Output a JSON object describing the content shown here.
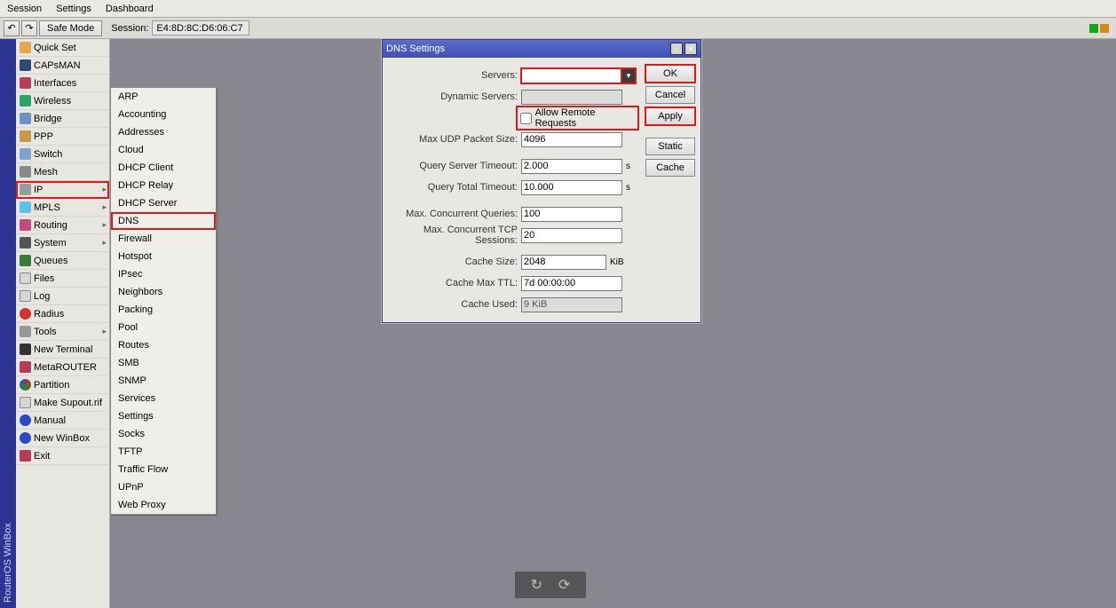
{
  "menubar": {
    "session": "Session",
    "settings": "Settings",
    "dashboard": "Dashboard"
  },
  "toolbar": {
    "undo_icon": "↶",
    "redo_icon": "↷",
    "safemode": "Safe Mode",
    "session_label": "Session:",
    "session_value": "E4:8D:8C:D6:06:C7"
  },
  "status": {
    "green_color": "#17a31a",
    "amber_color": "#d68a17"
  },
  "brand": "RouterOS WinBox",
  "sidebar": [
    {
      "label": "Quick Set",
      "icon": "i-quick",
      "arrow": false
    },
    {
      "label": "CAPsMAN",
      "icon": "i-caps",
      "arrow": false
    },
    {
      "label": "Interfaces",
      "icon": "i-if",
      "arrow": false
    },
    {
      "label": "Wireless",
      "icon": "i-wl",
      "arrow": false
    },
    {
      "label": "Bridge",
      "icon": "i-br",
      "arrow": false
    },
    {
      "label": "PPP",
      "icon": "i-ppp",
      "arrow": false
    },
    {
      "label": "Switch",
      "icon": "i-sw",
      "arrow": false
    },
    {
      "label": "Mesh",
      "icon": "i-mesh",
      "arrow": false
    },
    {
      "label": "IP",
      "icon": "i-ip",
      "arrow": true,
      "hl": true
    },
    {
      "label": "MPLS",
      "icon": "i-mpls",
      "arrow": true
    },
    {
      "label": "Routing",
      "icon": "i-rt",
      "arrow": true
    },
    {
      "label": "System",
      "icon": "i-sys",
      "arrow": true
    },
    {
      "label": "Queues",
      "icon": "i-queue",
      "arrow": false
    },
    {
      "label": "Files",
      "icon": "i-files",
      "arrow": false
    },
    {
      "label": "Log",
      "icon": "i-log",
      "arrow": false
    },
    {
      "label": "Radius",
      "icon": "i-radius",
      "arrow": false
    },
    {
      "label": "Tools",
      "icon": "i-tools",
      "arrow": true
    },
    {
      "label": "New Terminal",
      "icon": "i-term",
      "arrow": false
    },
    {
      "label": "MetaROUTER",
      "icon": "i-meta",
      "arrow": false
    },
    {
      "label": "Partition",
      "icon": "i-part",
      "arrow": false
    },
    {
      "label": "Make Supout.rif",
      "icon": "i-supout",
      "arrow": false
    },
    {
      "label": "Manual",
      "icon": "i-man",
      "arrow": false
    },
    {
      "label": "New WinBox",
      "icon": "i-newwb",
      "arrow": false
    },
    {
      "label": "Exit",
      "icon": "i-exit",
      "arrow": false
    }
  ],
  "submenu": [
    {
      "label": "ARP"
    },
    {
      "label": "Accounting"
    },
    {
      "label": "Addresses"
    },
    {
      "label": "Cloud"
    },
    {
      "label": "DHCP Client"
    },
    {
      "label": "DHCP Relay"
    },
    {
      "label": "DHCP Server"
    },
    {
      "label": "DNS",
      "hl": true
    },
    {
      "label": "Firewall"
    },
    {
      "label": "Hotspot"
    },
    {
      "label": "IPsec"
    },
    {
      "label": "Neighbors"
    },
    {
      "label": "Packing"
    },
    {
      "label": "Pool"
    },
    {
      "label": "Routes"
    },
    {
      "label": "SMB"
    },
    {
      "label": "SNMP"
    },
    {
      "label": "Services"
    },
    {
      "label": "Settings"
    },
    {
      "label": "Socks"
    },
    {
      "label": "TFTP"
    },
    {
      "label": "Traffic Flow"
    },
    {
      "label": "UPnP"
    },
    {
      "label": "Web Proxy"
    }
  ],
  "dialog": {
    "title": "DNS Settings",
    "labels": {
      "servers": "Servers:",
      "dynamic_servers": "Dynamic Servers:",
      "allow_remote": "Allow Remote Requests",
      "max_udp": "Max UDP Packet Size:",
      "query_server_timeout": "Query Server Timeout:",
      "query_total_timeout": "Query Total Timeout:",
      "max_conc_queries": "Max. Concurrent Queries:",
      "max_conc_tcp": "Max. Concurrent TCP Sessions:",
      "cache_size": "Cache Size:",
      "cache_max_ttl": "Cache Max TTL:",
      "cache_used": "Cache Used:"
    },
    "values": {
      "servers": "",
      "dynamic_servers": "",
      "allow_remote": false,
      "max_udp": "4096",
      "query_server_timeout": "2.000",
      "query_total_timeout": "10.000",
      "max_conc_queries": "100",
      "max_conc_tcp": "20",
      "cache_size": "2048",
      "cache_max_ttl": "7d 00:00:00",
      "cache_used": "9 KiB"
    },
    "units": {
      "s": "s",
      "kib": "KiB"
    },
    "buttons": {
      "ok": "OK",
      "cancel": "Cancel",
      "apply": "Apply",
      "static": "Static",
      "cache": "Cache"
    }
  },
  "lowbar": {
    "refresh": "↻",
    "reload": "⟳"
  }
}
